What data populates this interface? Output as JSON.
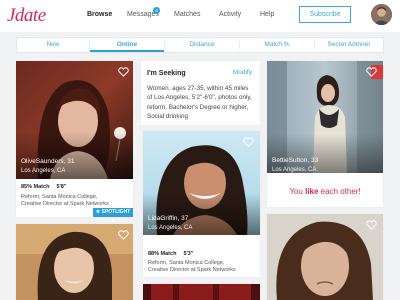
{
  "header": {
    "logo": "Jdate",
    "nav": [
      "Browse",
      "Messages",
      "Matches",
      "Activity",
      "Help"
    ],
    "messages_badge": "4",
    "subscribe_label": "Subscribe"
  },
  "tabs": [
    "New",
    "Online",
    "Distance",
    "Match %",
    "Secret Admirer"
  ],
  "cards": {
    "olive": {
      "name": "OliveSaunders, 31",
      "location": "Los Angeles, CA",
      "match": "85% Match",
      "height": "5'8\"",
      "school": "Reform, Santa Monica College,",
      "job": "Creative Director at Spark Networks",
      "spotlight": "★ SPOTLIGHT ★"
    },
    "lida": {
      "name": "LidaGriffin, 37",
      "location": "Los Angeles, CA",
      "match": "88% Match",
      "height": "5'3\"",
      "school": "Reform, Santa Monica College,",
      "job": "Creative Director at Spark Networks"
    },
    "bettie": {
      "name": "BettieSutton, 33",
      "location": "Los Angeles, CA",
      "like_prefix": "You ",
      "like_word": "like",
      "like_suffix": " each other!"
    }
  },
  "seeking": {
    "title": "I'm Seeking",
    "modify": "Modify",
    "text": "Women, ages 27-35, within 45 miles of Los Angeles, 5'2\"-6'0\", photos only, reform, Bachelor's Degree or higher, Social drinking"
  },
  "colors": {
    "accent": "#2b9fd6",
    "brand": "#cc2a5c",
    "like": "#d92a4f"
  }
}
